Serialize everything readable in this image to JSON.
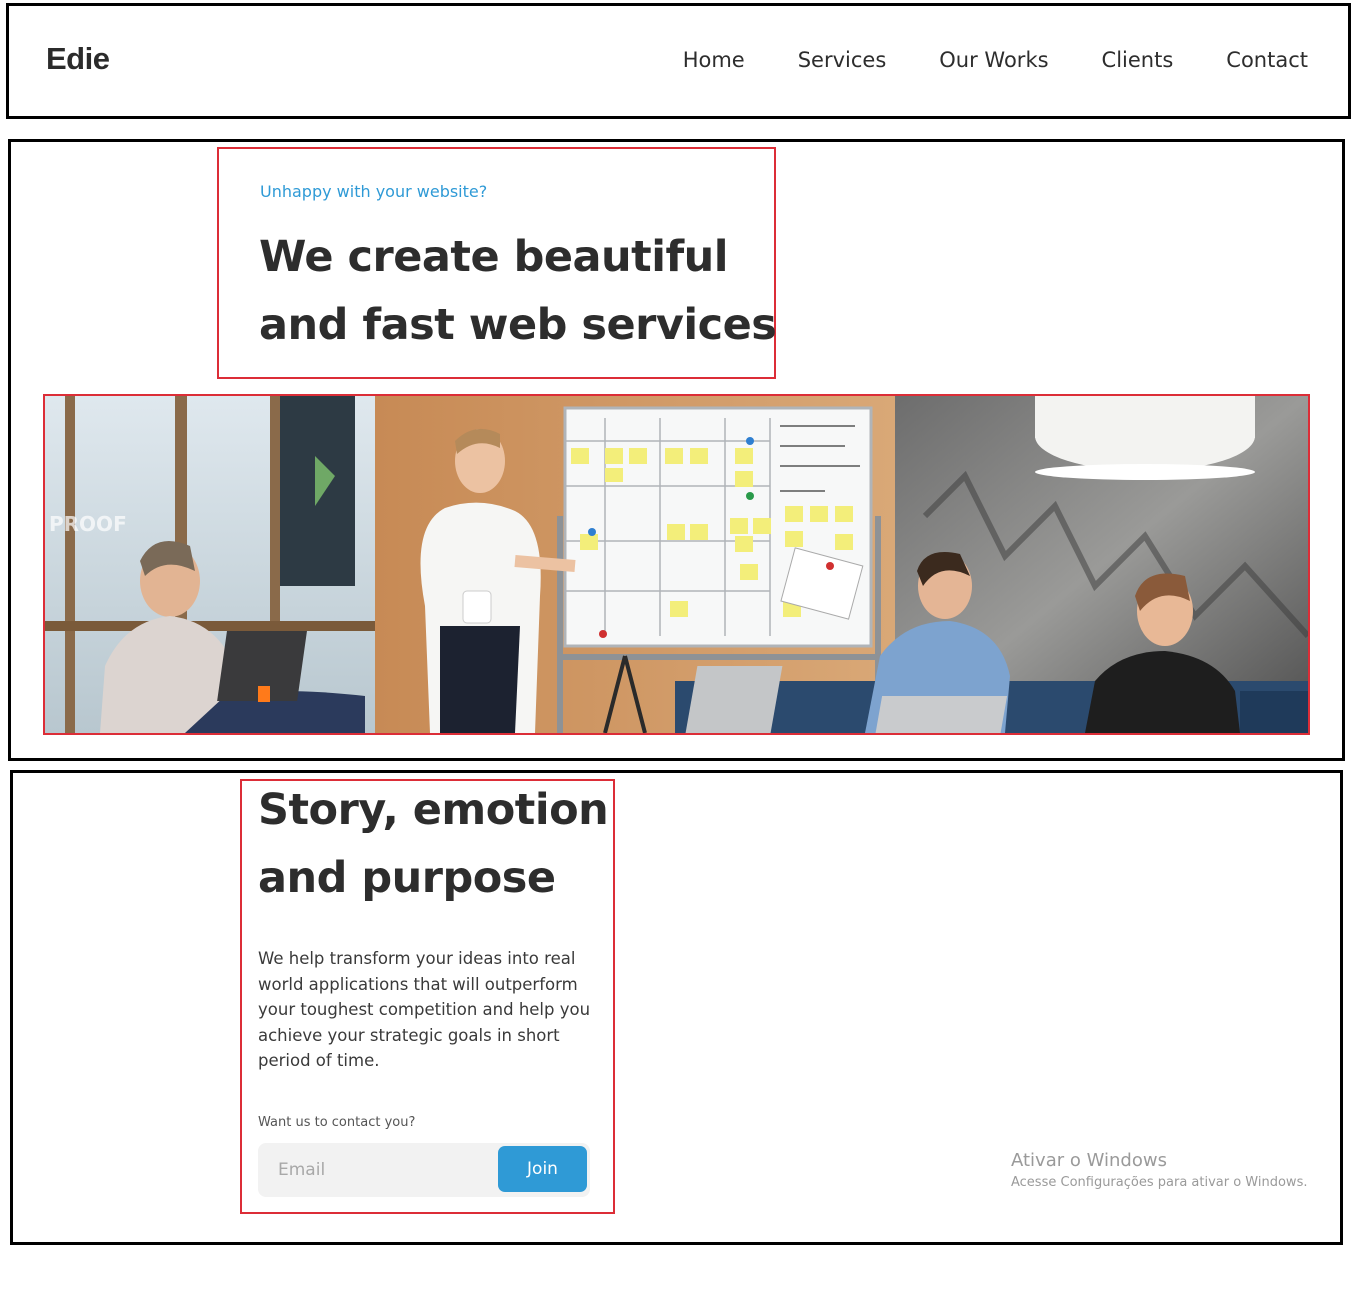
{
  "header": {
    "logo": "Edie",
    "nav": [
      "Home",
      "Services",
      "Our Works",
      "Clients",
      "Contact"
    ]
  },
  "hero": {
    "eyebrow": "Unhappy with your website?",
    "title_line1": "We create beautiful",
    "title_line2": "and fast web services",
    "image_alt": "team-meeting-photo"
  },
  "story": {
    "title_line1": "Story, emotion",
    "title_line2": "and purpose",
    "body": "We help transform your ideas into real world applications that will outperform your toughest competition and help you achieve your strategic goals in short period of time.",
    "contact_label": "Want us to contact you?",
    "email_placeholder": "Email",
    "join_label": "Join"
  },
  "windows_watermark": {
    "title": "Ativar o Windows",
    "subtitle": "Acesse Configurações para ativar o Windows."
  },
  "colors": {
    "accent": "#2f9ad6",
    "highlight_border": "#dc2d37",
    "text": "#2d2d2d"
  }
}
